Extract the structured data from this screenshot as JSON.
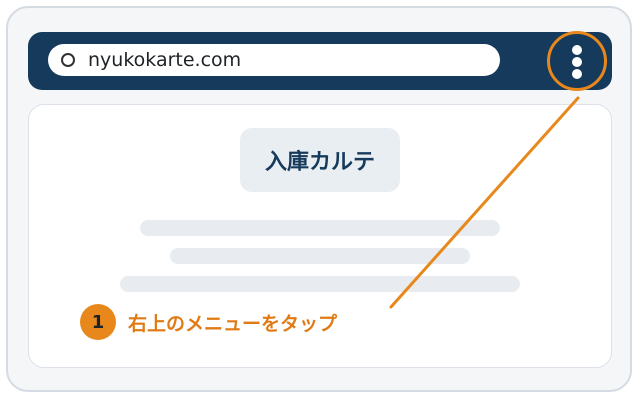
{
  "browser": {
    "url": "nyukokarte.com",
    "menu_icon": "kebab-menu-icon"
  },
  "page": {
    "logo_text": "入庫カルテ"
  },
  "instruction": {
    "step_number": "1",
    "text": "右上のメニューをタップ"
  },
  "colors": {
    "topbar": "#163a5c",
    "accent": "#e8881c",
    "placeholder": "#e8ecf0"
  }
}
